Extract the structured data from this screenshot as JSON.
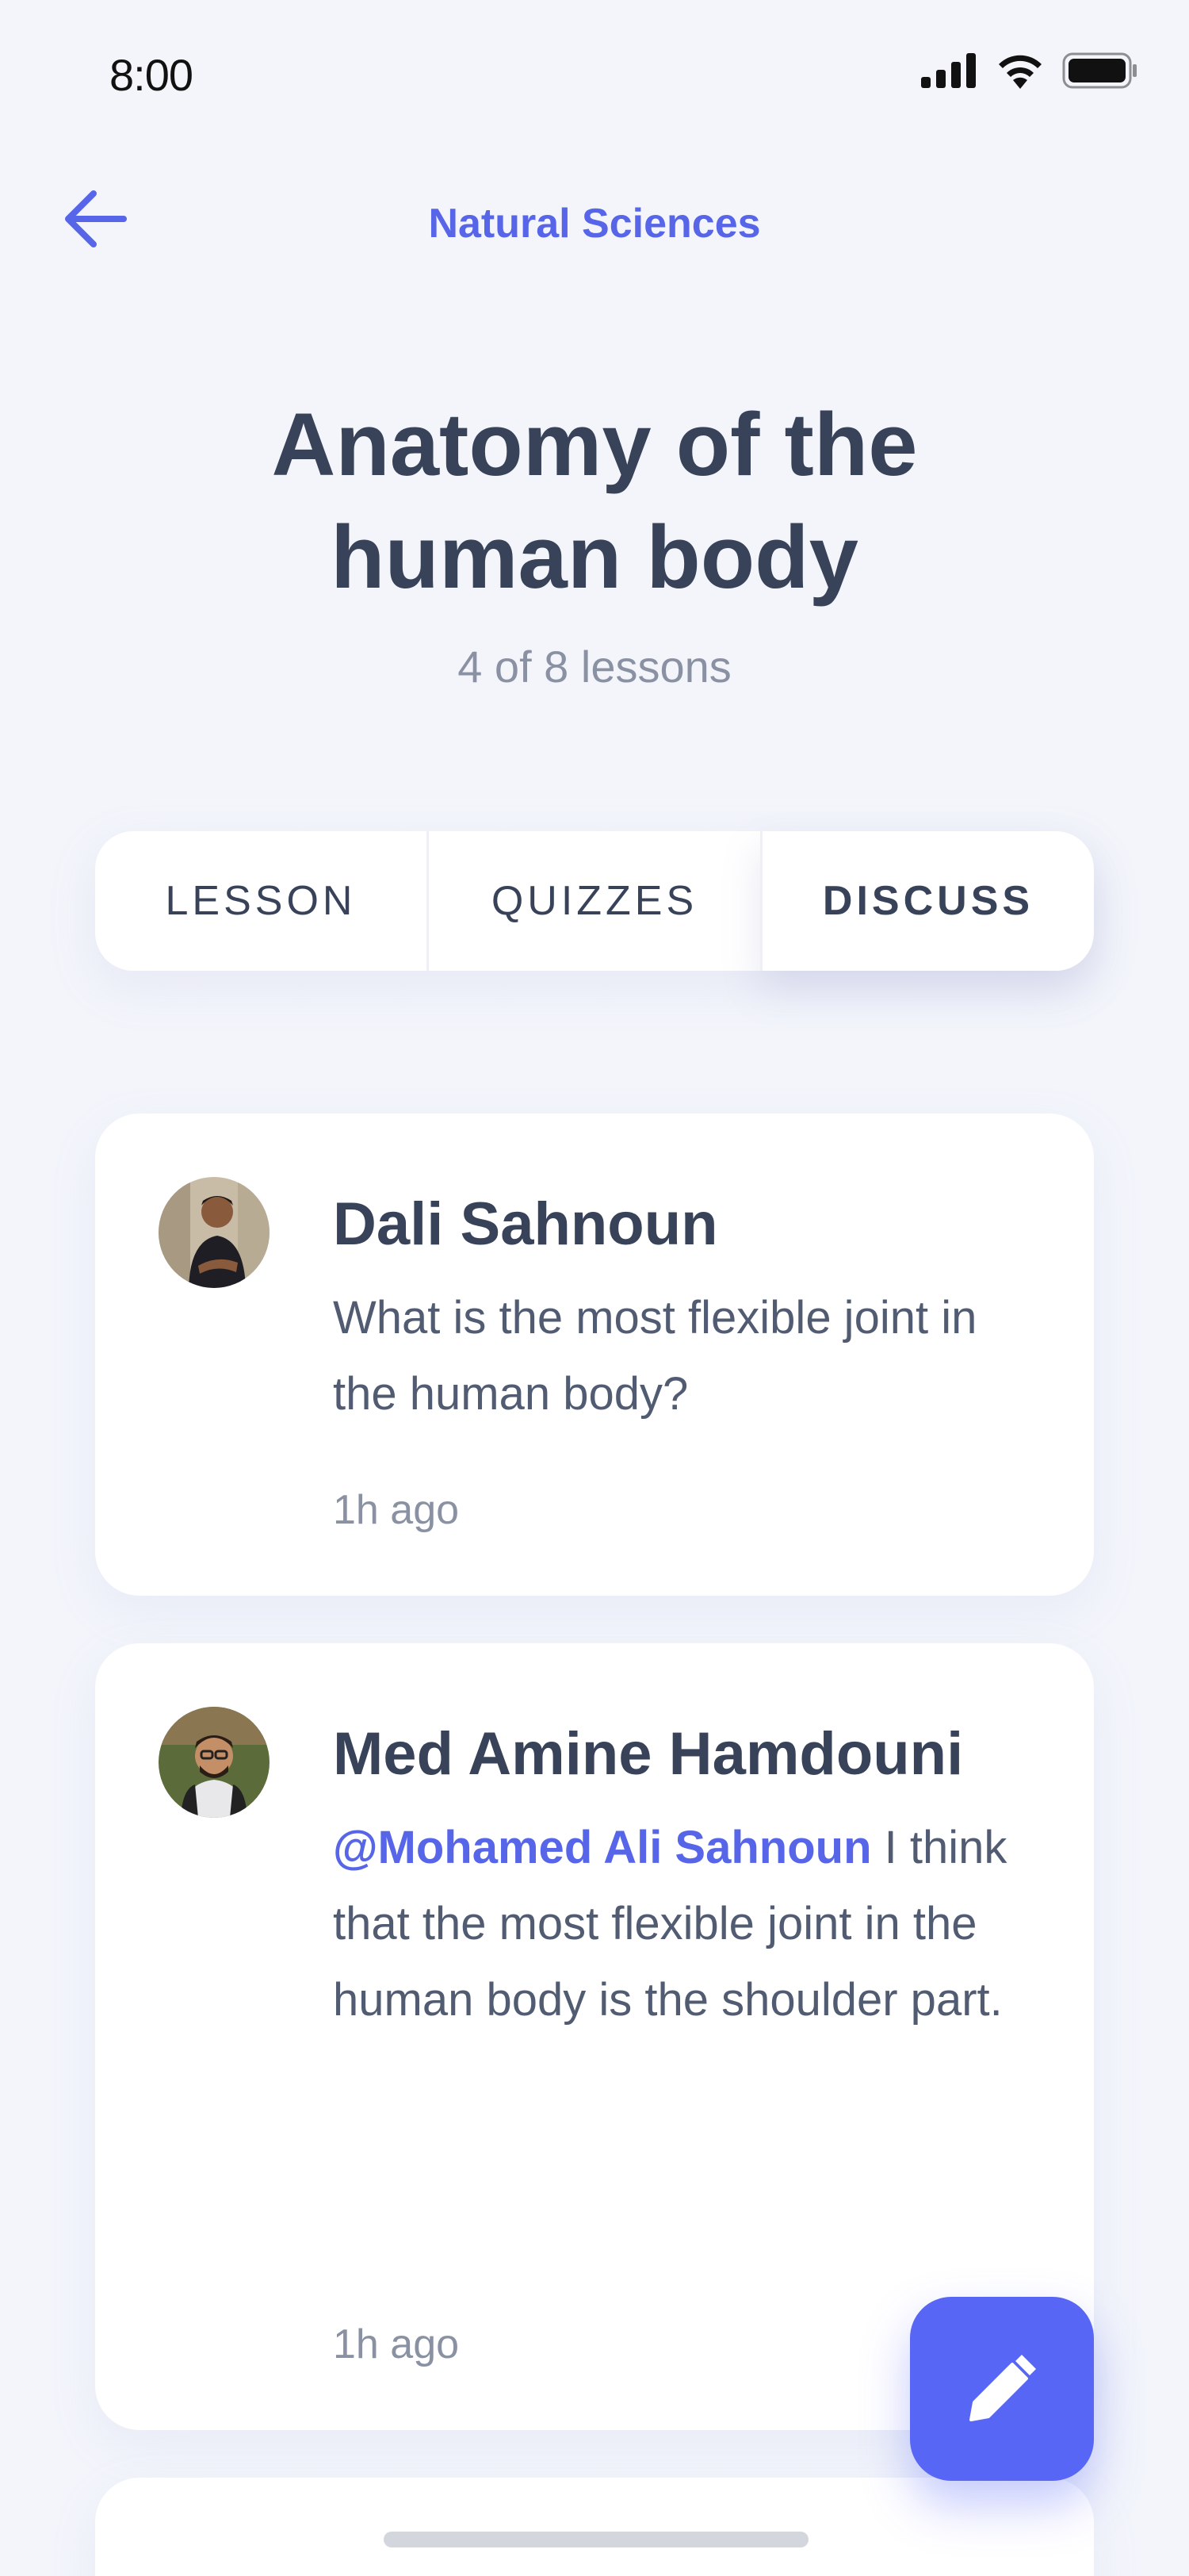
{
  "status": {
    "time": "8:00"
  },
  "nav": {
    "title": "Natural Sciences",
    "back_icon": "arrow-left-icon"
  },
  "course": {
    "title": "Anatomy of the human body",
    "progress": "4 of 8 lessons"
  },
  "tabs": [
    {
      "label": "LESSON",
      "active": false
    },
    {
      "label": "QUIZZES",
      "active": false
    },
    {
      "label": "DISCUSS",
      "active": true
    }
  ],
  "comments": [
    {
      "author": "Dali Sahnoun",
      "message": "What is the most flexible joint in the human body?",
      "time": "1h ago"
    },
    {
      "author": "Med Amine Hamdouni",
      "mention": "@Mohamed Ali Sahnoun",
      "message": " I think that the most flexible joint in the human body is the shoulder part.",
      "time": "1h ago"
    }
  ],
  "colors": {
    "accent": "#5766e8",
    "fab": "#5766f5",
    "text": "#38435a",
    "muted": "#8a91a3",
    "background": "#f3f5fb"
  },
  "fab": {
    "icon": "pencil-icon"
  }
}
